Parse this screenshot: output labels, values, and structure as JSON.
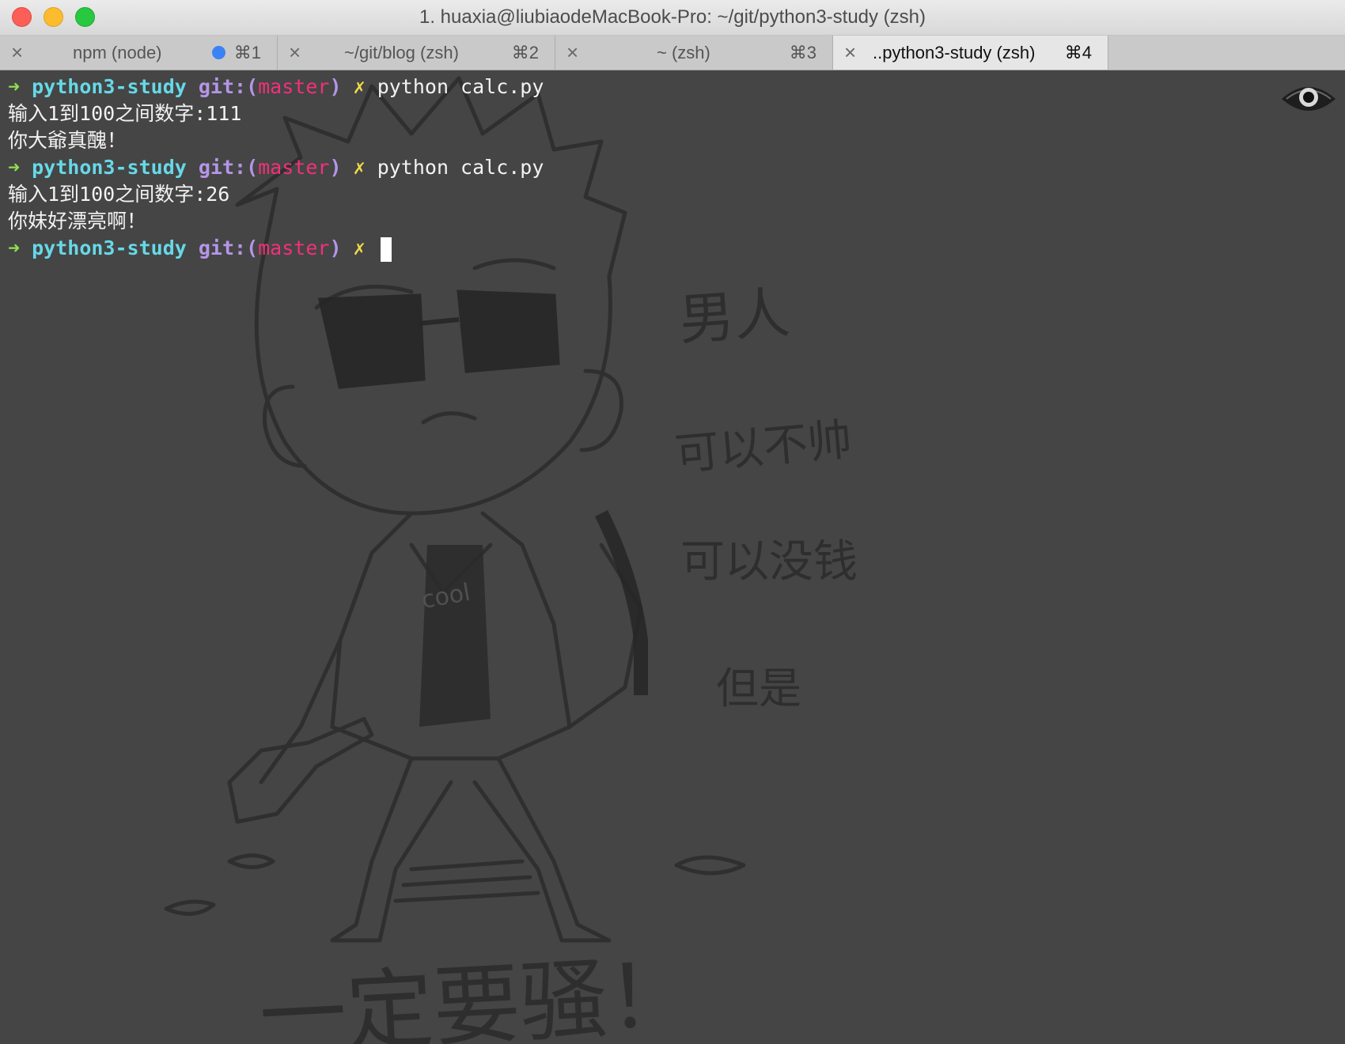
{
  "window": {
    "title": "1. huaxia@liubiaodeMacBook-Pro: ~/git/python3-study (zsh)"
  },
  "tabs": [
    {
      "label": "npm (node)",
      "shortcut": "⌘1",
      "close": "×",
      "has_activity": true
    },
    {
      "label": "~/git/blog (zsh)",
      "shortcut": "⌘2",
      "close": "×"
    },
    {
      "label": "~ (zsh)",
      "shortcut": "⌘3",
      "close": "×"
    },
    {
      "label": "..python3-study (zsh)",
      "shortcut": "⌘4",
      "close": "×",
      "active": true
    }
  ],
  "prompt": {
    "arrow": "➜",
    "dir": "python3-study",
    "git_prefix": "git:(",
    "branch": "master",
    "git_suffix": ")",
    "dirty": "✗"
  },
  "output": [
    {
      "type": "prompt",
      "command": "python calc.py"
    },
    {
      "type": "text",
      "text": "输入1到100之间数字:111"
    },
    {
      "type": "text",
      "text": "你大爺真醜！"
    },
    {
      "type": "prompt",
      "command": "python calc.py"
    },
    {
      "type": "text",
      "text": "输入1到100之间数字:26"
    },
    {
      "type": "text",
      "text": "你妹好漂亮啊！"
    },
    {
      "type": "prompt",
      "command": "",
      "cursor": true
    }
  ],
  "background_art": {
    "texts": [
      "男人",
      "可以不帅",
      "可以没钱",
      "但是",
      "一定要骚！",
      "cool"
    ]
  },
  "colors": {
    "arrow": "#8ee04f",
    "dir": "#66d9e8",
    "git": "#b595e8",
    "branch": "#f2307a",
    "dirty": "#f3d94a",
    "terminal_bg": "#454545"
  },
  "icons": {
    "eye": "eye-icon"
  }
}
